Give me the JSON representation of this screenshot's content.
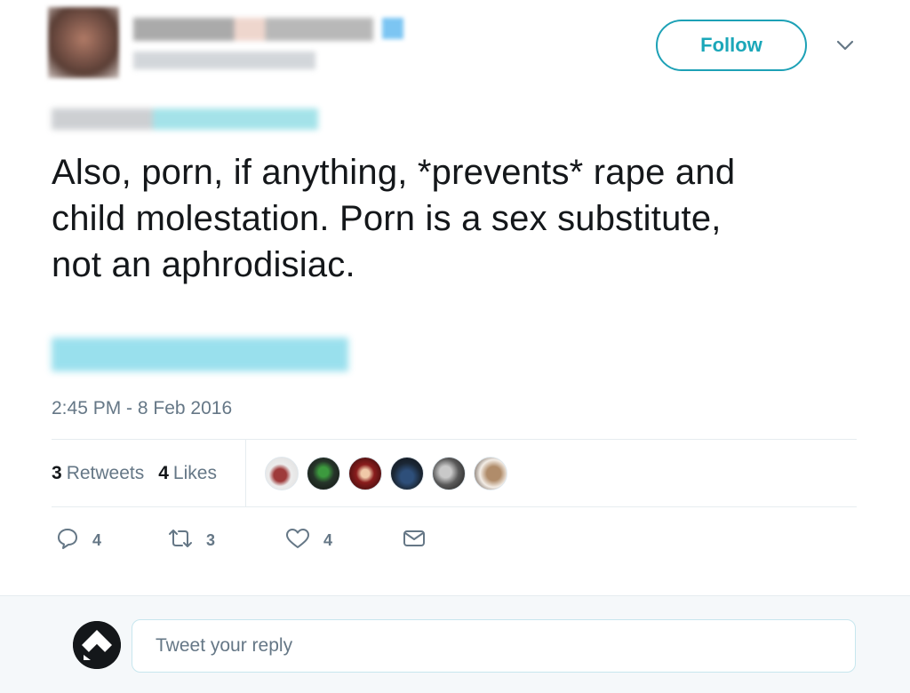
{
  "header": {
    "follow_label": "Follow"
  },
  "tweet": {
    "text": "Also, porn, if anything, *prevents* rape and\nchild molestation. Porn is a sex substitute,\nnot an aphrodisiac.",
    "timestamp": "2:45 PM - 8 Feb 2016"
  },
  "stats": {
    "retweets_count": "3",
    "retweets_label": "Retweets",
    "likes_count": "4",
    "likes_label": "Likes"
  },
  "actions": {
    "reply_count": "4",
    "retweet_count": "3",
    "like_count": "4"
  },
  "reply_box": {
    "placeholder": "Tweet your reply"
  },
  "colors": {
    "accent": "#1da1b6",
    "muted_text": "#657786",
    "divider": "#e6ecf0",
    "reply_bar_bg": "#f5f8fa"
  },
  "icons": [
    "caret-down-icon",
    "reply-icon",
    "retweet-icon",
    "like-icon",
    "direct-message-icon"
  ]
}
